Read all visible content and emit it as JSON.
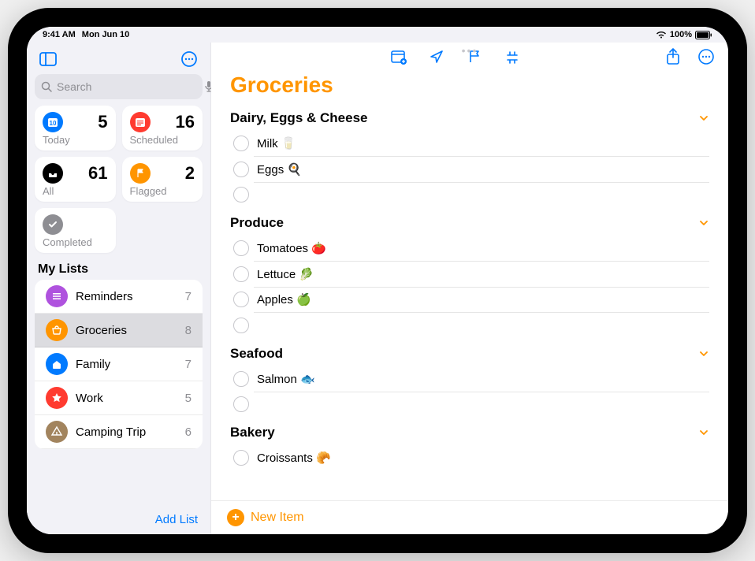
{
  "status": {
    "time": "9:41 AM",
    "date": "Mon Jun 10",
    "battery": "100%"
  },
  "sidebar": {
    "search_placeholder": "Search",
    "cards": {
      "today": {
        "label": "Today",
        "count": "5"
      },
      "scheduled": {
        "label": "Scheduled",
        "count": "16"
      },
      "all": {
        "label": "All",
        "count": "61"
      },
      "flagged": {
        "label": "Flagged",
        "count": "2"
      },
      "completed": {
        "label": "Completed"
      }
    },
    "section_label": "My Lists",
    "lists": [
      {
        "name": "Reminders",
        "count": "7",
        "color": "#af52de"
      },
      {
        "name": "Groceries",
        "count": "8",
        "color": "#ff9500",
        "selected": true
      },
      {
        "name": "Family",
        "count": "7",
        "color": "#007aff"
      },
      {
        "name": "Work",
        "count": "5",
        "color": "#ff3b30"
      },
      {
        "name": "Camping Trip",
        "count": "6",
        "color": "#a2845e"
      }
    ],
    "add_list": "Add List"
  },
  "main": {
    "title": "Groceries",
    "title_color": "#ff9500",
    "new_item": "New Item",
    "sections": [
      {
        "name": "Dairy, Eggs & Cheese",
        "items": [
          {
            "text": "Milk 🥛"
          },
          {
            "text": "Eggs 🍳"
          },
          {
            "text": ""
          }
        ]
      },
      {
        "name": "Produce",
        "items": [
          {
            "text": "Tomatoes 🍅"
          },
          {
            "text": "Lettuce 🥬"
          },
          {
            "text": "Apples 🍏"
          },
          {
            "text": ""
          }
        ]
      },
      {
        "name": "Seafood",
        "items": [
          {
            "text": "Salmon 🐟"
          },
          {
            "text": ""
          }
        ]
      },
      {
        "name": "Bakery",
        "items": [
          {
            "text": "Croissants 🥐"
          }
        ]
      }
    ]
  }
}
